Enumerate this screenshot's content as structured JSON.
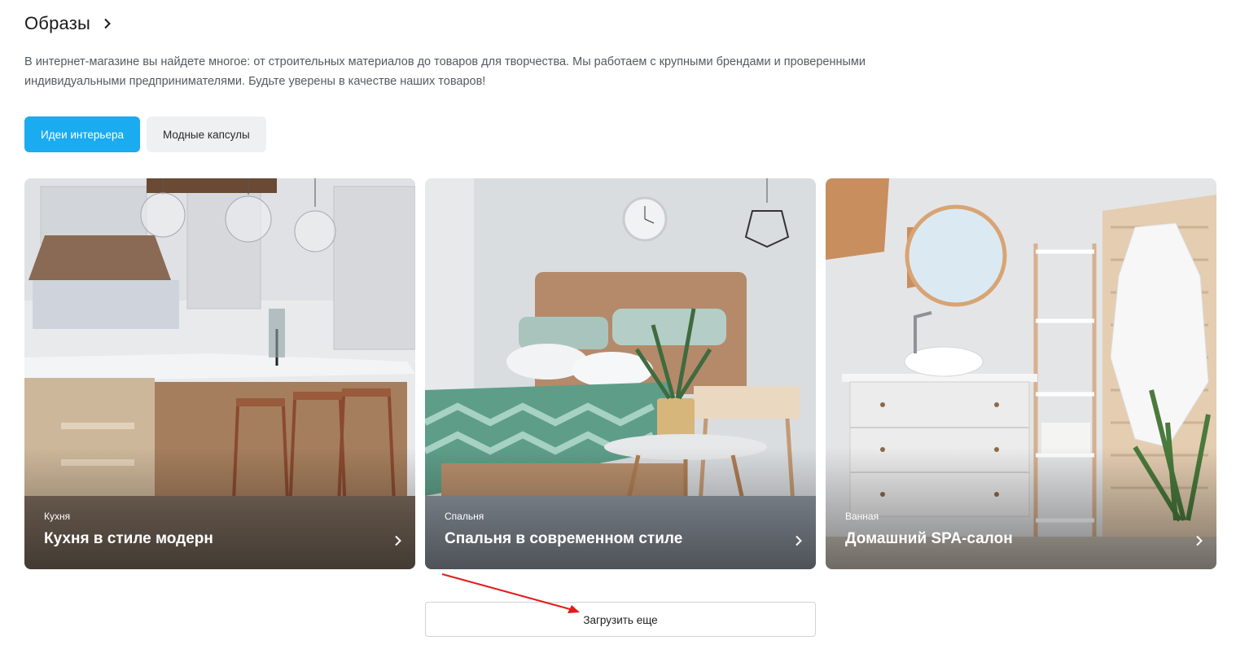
{
  "section": {
    "title": "Образы",
    "title_icon": "chevron-right-icon",
    "description": "В интернет-магазине вы найдете многое: от строительных материалов до товаров для творчества. Мы работаем с крупными брендами и проверенными индивидуальными предпринимателями. Будьте уверены в качестве наших товаров!"
  },
  "tabs": [
    {
      "label": "Идеи интерьера",
      "active": true
    },
    {
      "label": "Модные капсулы",
      "active": false
    }
  ],
  "cards": [
    {
      "category": "Кухня",
      "title": "Кухня в стиле модерн",
      "icon": "chevron-right-icon",
      "image": "kitchen-photo"
    },
    {
      "category": "Спальня",
      "title": "Спальня в современном стиле",
      "icon": "chevron-right-icon",
      "image": "bedroom-photo"
    },
    {
      "category": "Ванная",
      "title": "Домашний SPA-салон",
      "icon": "chevron-right-icon",
      "image": "bathroom-photo"
    }
  ],
  "load_more": {
    "label": "Загрузить еще"
  },
  "colors": {
    "accent": "#1aabf0",
    "tab_inactive_bg": "#eef0f2",
    "annotation_arrow": "#e31b1b"
  }
}
